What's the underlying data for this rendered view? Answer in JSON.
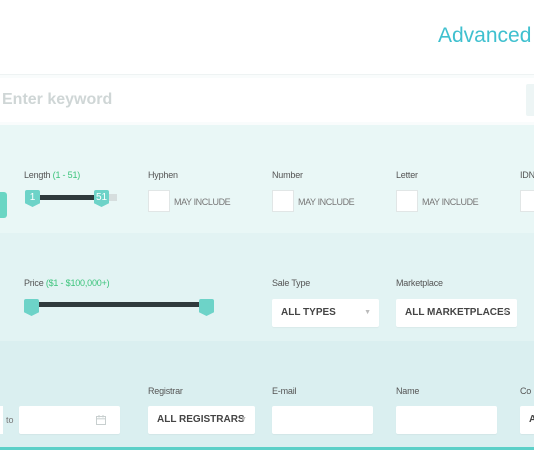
{
  "header": {
    "title": "Advanced S"
  },
  "search": {
    "placeholder": "Enter keyword"
  },
  "filters_row1": {
    "length": {
      "label": "Length",
      "range": "(1 - 51)",
      "min": "1",
      "max": "51"
    },
    "hyphen": {
      "label": "Hyphen",
      "option": "MAY INCLUDE"
    },
    "number": {
      "label": "Number",
      "option": "MAY INCLUDE"
    },
    "letter": {
      "label": "Letter",
      "option": "MAY INCLUDE"
    },
    "idn": {
      "label": "IDN"
    }
  },
  "filters_row2": {
    "price": {
      "label": "Price",
      "range": "($1 - $100,000+)"
    },
    "sale_type": {
      "label": "Sale Type",
      "value": "ALL TYPES"
    },
    "marketplace": {
      "label": "Marketplace",
      "value": "ALL MARKETPLACES"
    }
  },
  "filters_row3": {
    "date": {
      "to_label": "to"
    },
    "registrar": {
      "label": "Registrar",
      "value": "ALL REGISTRARS"
    },
    "email": {
      "label": "E-mail"
    },
    "name": {
      "label": "Name"
    },
    "country": {
      "label": "Co",
      "value": "A"
    }
  },
  "colors": {
    "accent": "#3fc0cf",
    "handle": "#6dd3c8",
    "green": "#3cc47c"
  },
  "icons": {
    "calendar": "calendar-icon",
    "caret": "caret-down-icon"
  }
}
